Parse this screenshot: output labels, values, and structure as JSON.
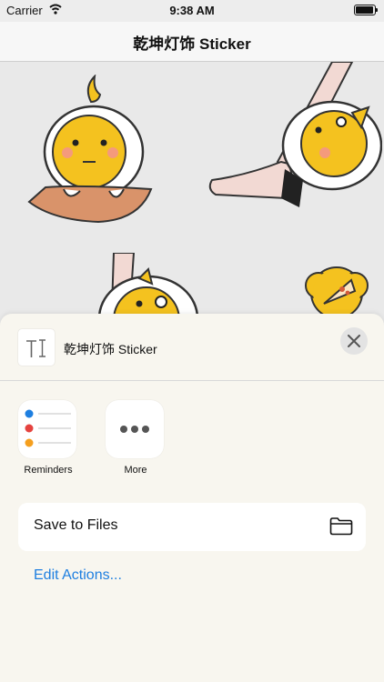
{
  "status_bar": {
    "carrier": "Carrier",
    "time": "9:38 AM",
    "battery_level": 0.95
  },
  "nav": {
    "title": "乾坤灯饰 Sticker"
  },
  "share_sheet": {
    "title": "乾坤灯饰 Sticker",
    "apps": [
      {
        "label": "Reminders",
        "icon": "reminders-icon"
      },
      {
        "label": "More",
        "icon": "more-icon"
      }
    ],
    "actions": [
      {
        "label": "Save to Files",
        "icon": "folder-icon"
      }
    ],
    "edit_label": "Edit Actions..."
  },
  "colors": {
    "accent": "#1e7fe0",
    "sticker_yellow": "#f4c21f",
    "skin": "#f2d9d3"
  }
}
